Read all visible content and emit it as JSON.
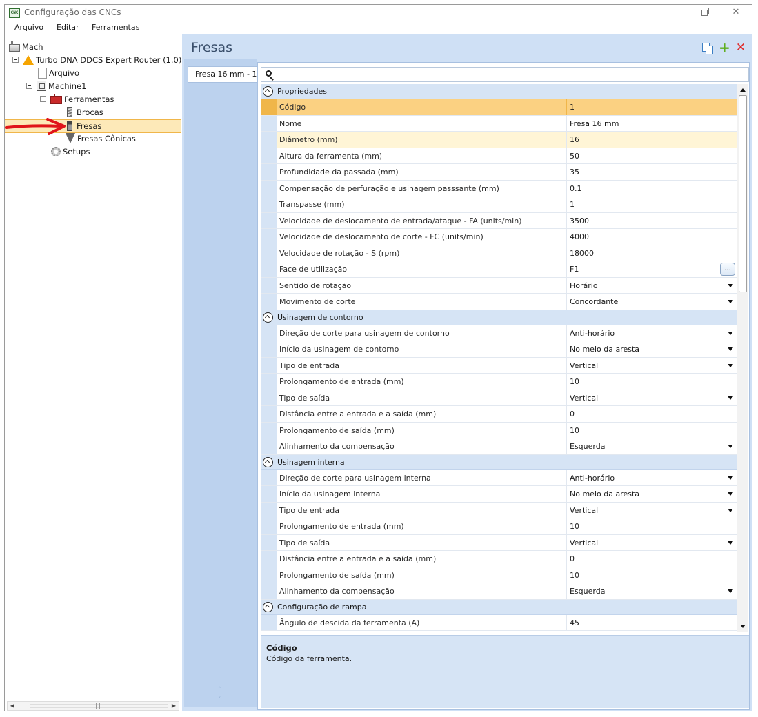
{
  "window": {
    "title": "Configuração das CNCs",
    "app_icon_text": "CNC",
    "minimize": "—",
    "close": "✕"
  },
  "menu": [
    "Arquivo",
    "Editar",
    "Ferramentas"
  ],
  "tree": {
    "root": "Mach",
    "router": "Turbo DNA DDCS Expert Router (1.0)",
    "arquivo": "Arquivo",
    "machine": "Machine1",
    "ferramentas": "Ferramentas",
    "brocas": "Brocas",
    "fresas": "Fresas",
    "fresas_conicas": "Fresas Cônicas",
    "setups": "Setups",
    "selected": "Fresas"
  },
  "scroll_glyphs": {
    "left": "◀",
    "right": "▶",
    "up": "˄",
    "down": "˅"
  },
  "main": {
    "title": "Fresas",
    "tab_label": "Fresa 16 mm - 1",
    "search_placeholder": "",
    "ellipsis": "..."
  },
  "grid": {
    "propriedades": {
      "label": "Propriedades",
      "rows": [
        {
          "name": "Código",
          "value": "1"
        },
        {
          "name": "Nome",
          "value": "Fresa 16 mm"
        },
        {
          "name": "Diâmetro (mm)",
          "value": "16"
        },
        {
          "name": "Altura da ferramenta (mm)",
          "value": "50"
        },
        {
          "name": "Profundidade da passada (mm)",
          "value": "35"
        },
        {
          "name": "Compensação de perfuração e usinagem passsante (mm)",
          "value": "0.1"
        },
        {
          "name": "Transpasse (mm)",
          "value": "1"
        },
        {
          "name": "Velocidade de deslocamento de entrada/ataque - FA (units/min)",
          "value": "3500"
        },
        {
          "name": "Velocidade de deslocamento de corte - FC (units/min)",
          "value": "4000"
        },
        {
          "name": "Velocidade de rotação - S (rpm)",
          "value": "18000"
        },
        {
          "name": "Face de utilização",
          "value": "F1"
        },
        {
          "name": "Sentido de rotação",
          "value": "Horário"
        },
        {
          "name": "Movimento de corte",
          "value": "Concordante"
        }
      ]
    },
    "contorno": {
      "label": "Usinagem de contorno",
      "rows": [
        {
          "name": "Direção de corte para usinagem de contorno",
          "value": "Anti-horário"
        },
        {
          "name": "Início da usinagem de contorno",
          "value": "No meio da aresta"
        },
        {
          "name": "Tipo de entrada",
          "value": "Vertical"
        },
        {
          "name": "Prolongamento de entrada (mm)",
          "value": "10"
        },
        {
          "name": "Tipo de saída",
          "value": "Vertical"
        },
        {
          "name": "Distância entre a entrada e a saída (mm)",
          "value": "0"
        },
        {
          "name": "Prolongamento de saída (mm)",
          "value": "10"
        },
        {
          "name": "Alinhamento da compensação",
          "value": "Esquerda"
        }
      ]
    },
    "interna": {
      "label": "Usinagem interna",
      "rows": [
        {
          "name": "Direção de corte para usinagem interna",
          "value": "Anti-horário"
        },
        {
          "name": "Início da usinagem interna",
          "value": "No meio da aresta"
        },
        {
          "name": "Tipo de entrada",
          "value": "Vertical"
        },
        {
          "name": "Prolongamento de entrada (mm)",
          "value": "10"
        },
        {
          "name": "Tipo de saída",
          "value": "Vertical"
        },
        {
          "name": "Distância entre a entrada e a saída (mm)",
          "value": "0"
        },
        {
          "name": "Prolongamento de saída (mm)",
          "value": "10"
        },
        {
          "name": "Alinhamento da compensação",
          "value": "Esquerda"
        }
      ]
    },
    "rampa": {
      "label": "Configuração de rampa",
      "rows": [
        {
          "name": "Ângulo de descida da ferramenta (A)",
          "value": "45"
        }
      ]
    }
  },
  "description": {
    "title": "Código",
    "text": "Código da ferramenta."
  },
  "colors": {
    "selected_row": "#fbd182",
    "category_bg": "#d6e4f5",
    "panel_bg": "#cfe0f5",
    "arrow": "#e0151a",
    "add_icon": "#5fae1f",
    "delete_icon": "#e02b2b"
  }
}
